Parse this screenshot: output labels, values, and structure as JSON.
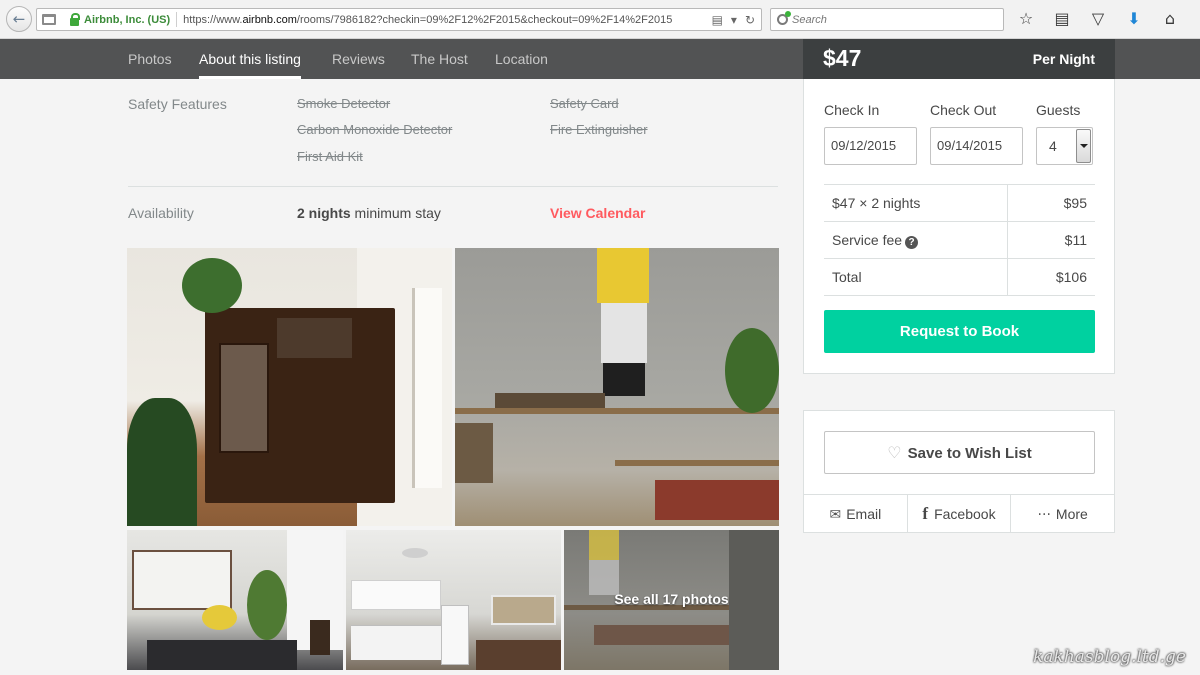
{
  "browser": {
    "identity": "Airbnb, Inc. (US)",
    "url_prefix": "https://www.",
    "url_domain": "airbnb.com",
    "url_rest": "/rooms/7986182?checkin=09%2F12%2F2015&checkout=09%2F14%2F2015",
    "search_placeholder": "Search"
  },
  "subnav": {
    "items": [
      "Photos",
      "About this listing",
      "Reviews",
      "The Host",
      "Location"
    ],
    "active_index": 1
  },
  "listing": {
    "safety_label": "Safety Features",
    "safety_features": [
      "Smoke Detector",
      "Safety Card",
      "Carbon Monoxide Detector",
      "Fire Extinguisher",
      "First Aid Kit"
    ],
    "availability_label": "Availability",
    "min_stay_bold": "2 nights",
    "min_stay_rest": " minimum stay",
    "view_calendar": "View Calendar"
  },
  "photos": {
    "see_all": "See all 17 photos"
  },
  "booking": {
    "price": "$47",
    "per": "Per Night",
    "check_in_label": "Check In",
    "check_out_label": "Check Out",
    "guests_label": "Guests",
    "check_in": "09/12/2015",
    "check_out": "09/14/2015",
    "guests": "4",
    "rows": [
      {
        "label": "$47 × 2 nights",
        "value": "$95"
      },
      {
        "label": "Service fee",
        "value": "$11"
      },
      {
        "label": "Total",
        "value": "$106"
      }
    ],
    "request_button": "Request to Book",
    "accent": "#00d1a0"
  },
  "share": {
    "wishlist": "Save to Wish List",
    "email": "Email",
    "facebook": "Facebook",
    "more": "More"
  },
  "watermark": "kakhasblog.ltd.ge"
}
